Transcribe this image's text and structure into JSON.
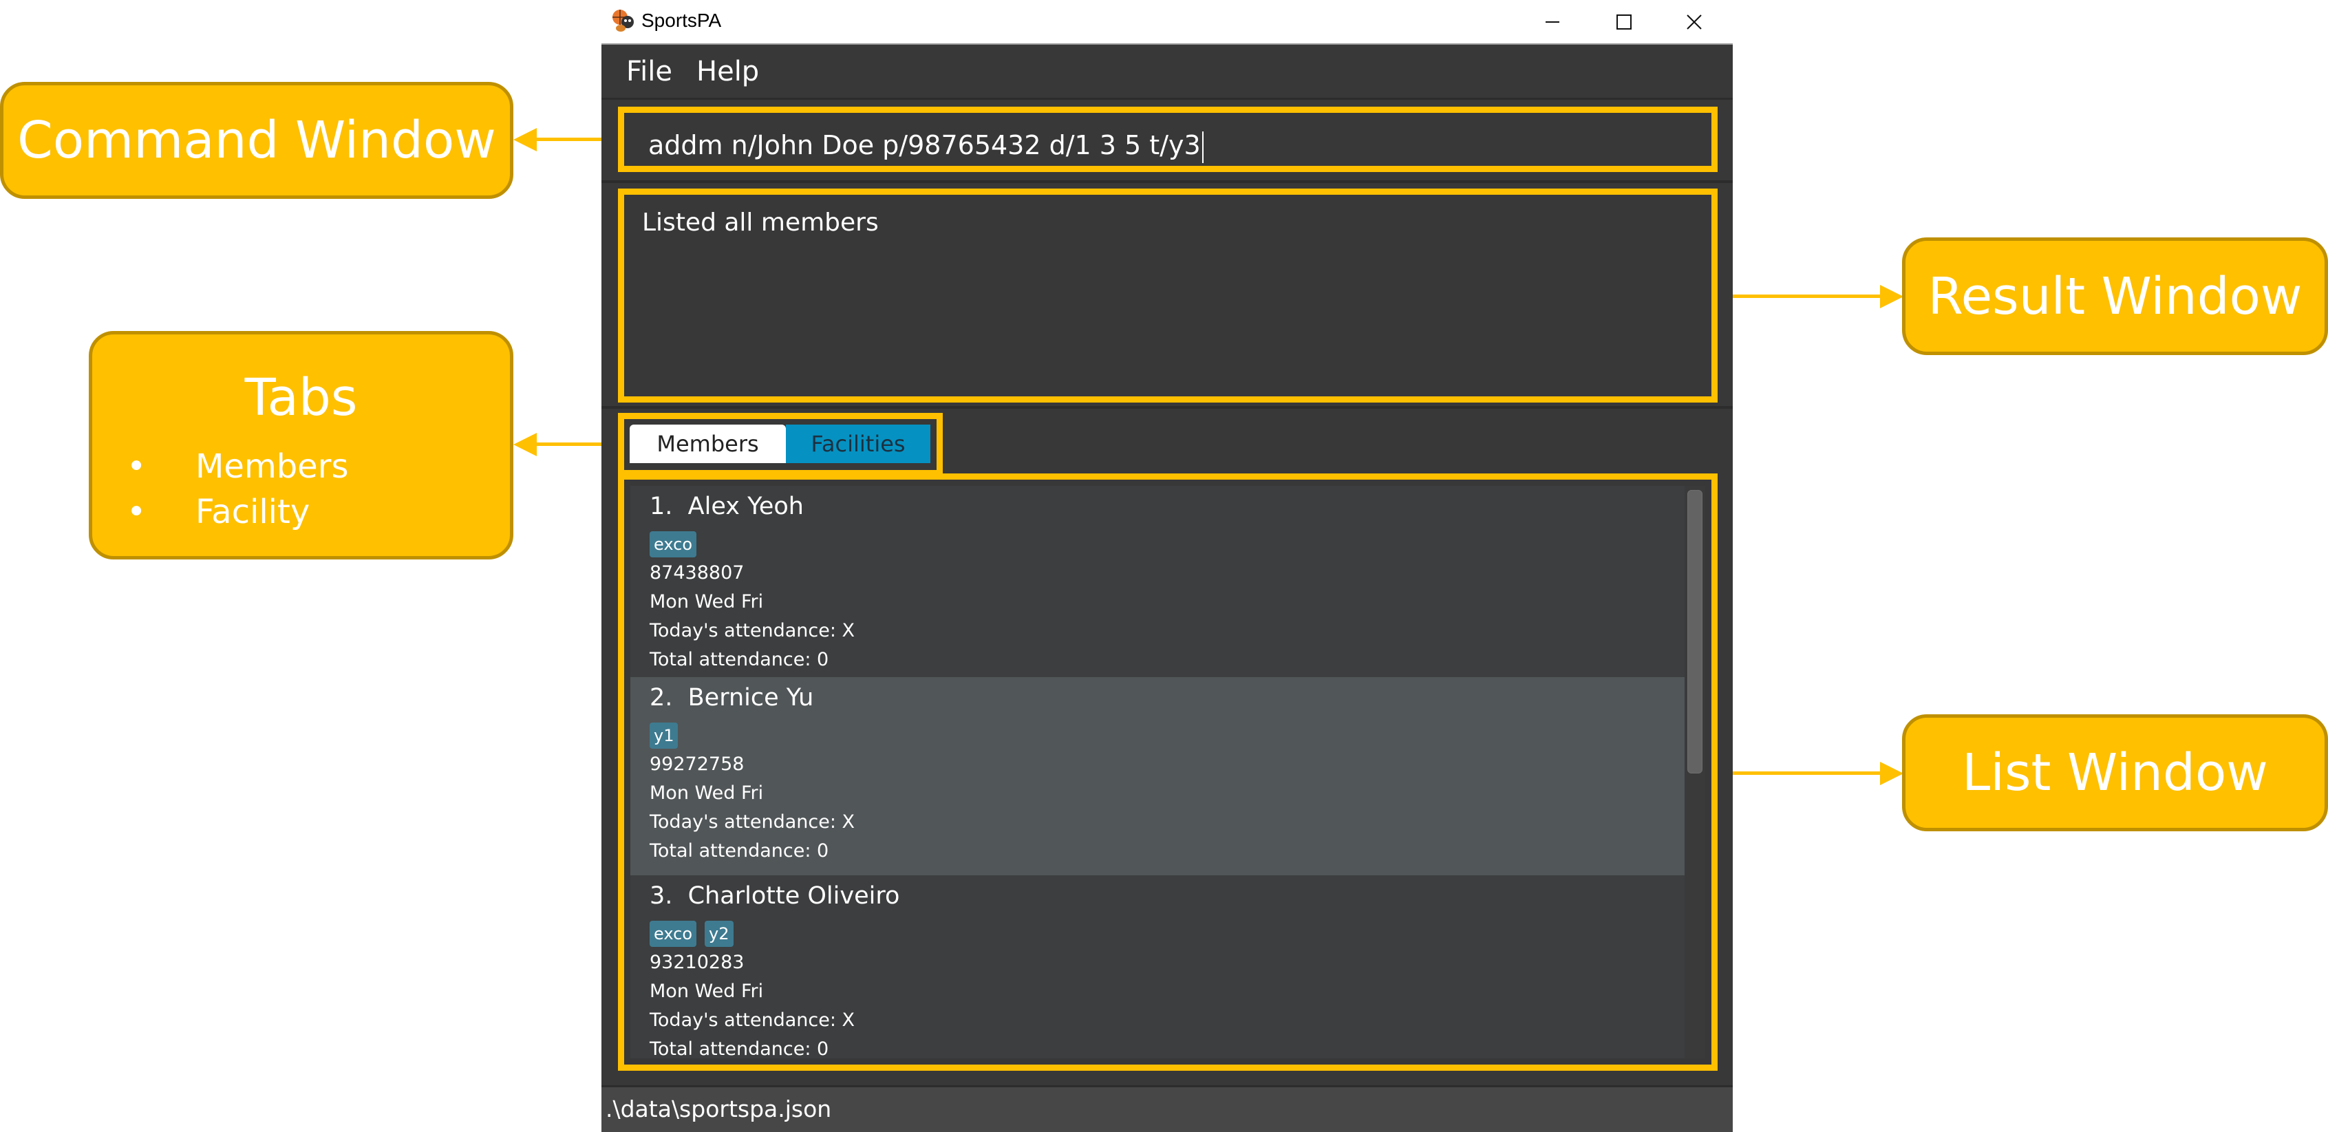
{
  "annotations": {
    "command_window": "Command Window",
    "result_window": "Result Window",
    "list_window": "List Window",
    "tabs": {
      "title": "Tabs",
      "bullet": "•",
      "items": [
        "Members",
        "Facility"
      ]
    },
    "accent_color": "#FFC000"
  },
  "window": {
    "title": "SportsPA",
    "controls": {
      "minimize": "minimize",
      "maximize": "maximize",
      "close": "close"
    }
  },
  "menu": {
    "items": [
      "File",
      "Help"
    ]
  },
  "command_box": {
    "value": "addm n/John Doe p/98765432 d/1 3 5 t/y3"
  },
  "result_box": {
    "text": "Listed all members"
  },
  "tabs": [
    {
      "label": "Members",
      "selected": true
    },
    {
      "label": "Facilities",
      "selected": false
    }
  ],
  "members": [
    {
      "index": "1.",
      "name": "Alex Yeoh",
      "tags": [
        "exco"
      ],
      "phone": "87438807",
      "days": "Mon Wed Fri",
      "today_attendance": "Today's attendance: X",
      "total_attendance": "Total attendance: 0"
    },
    {
      "index": "2.",
      "name": "Bernice Yu",
      "tags": [
        "y1"
      ],
      "phone": "99272758",
      "days": "Mon Wed Fri",
      "today_attendance": "Today's attendance: X",
      "total_attendance": "Total attendance: 0"
    },
    {
      "index": "3.",
      "name": "Charlotte Oliveiro",
      "tags": [
        "exco",
        "y2"
      ],
      "phone": "93210283",
      "days": "Mon Wed Fri",
      "today_attendance": "Today's attendance: X",
      "total_attendance": "Total attendance: 0"
    }
  ],
  "status_bar": {
    "path": ".\\data\\sportspa.json"
  }
}
